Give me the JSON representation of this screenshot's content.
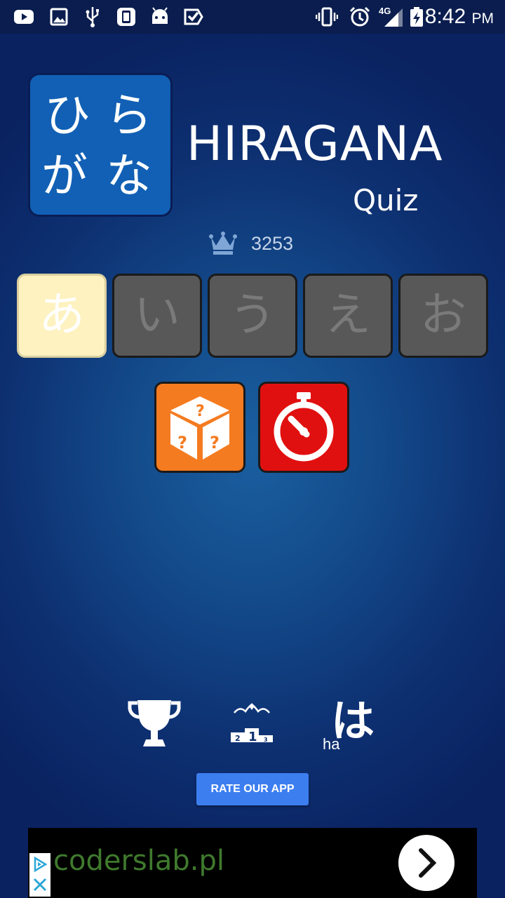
{
  "status_bar": {
    "time": "8:42",
    "ampm": "PM",
    "network": "4G",
    "icons": [
      "youtube-icon",
      "gallery-icon",
      "usb-icon",
      "sync-icon",
      "android-icon",
      "check-tag-icon",
      "vibrate-icon",
      "alarm-icon",
      "signal-icon",
      "battery-charging-icon"
    ]
  },
  "logo": {
    "chars": [
      "ひ",
      "ら",
      "が",
      "な"
    ],
    "title": "HIRAGANA",
    "subtitle": "Quiz",
    "box_color": "#1160b5"
  },
  "score": {
    "icon": "crown-icon",
    "value": "3253"
  },
  "kana_tiles": [
    {
      "char": "あ",
      "selected": true
    },
    {
      "char": "い",
      "selected": false
    },
    {
      "char": "う",
      "selected": false
    },
    {
      "char": "え",
      "selected": false
    },
    {
      "char": "お",
      "selected": false
    }
  ],
  "modes": [
    {
      "icon": "random-dice-icon",
      "color": "#f47b20"
    },
    {
      "icon": "stopwatch-icon",
      "color": "#e11010"
    }
  ],
  "bottom_icons": {
    "trophy": "trophy-icon",
    "leaderboard": "podium-icon",
    "podium_numbers": [
      "2",
      "1",
      "3"
    ],
    "chart": {
      "kana": "は",
      "romaji": "ha"
    }
  },
  "rate_button": {
    "label": "RATE OUR APP",
    "color": "#3c7ef0"
  },
  "ad": {
    "text": "coderslab.pl",
    "text_color": "#3f7a2d"
  }
}
